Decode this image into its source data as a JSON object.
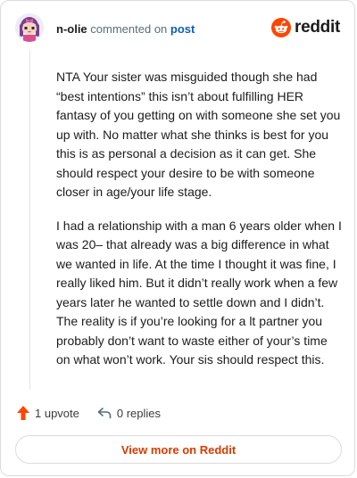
{
  "header": {
    "username": "n-olie",
    "verb": "commented on",
    "post_link": "post",
    "brand": "reddit"
  },
  "comment": {
    "paragraphs": [
      "NTA Your sister was misguided though she had “best intentions” this isn’t about fulfilling HER fantasy of you getting on with someone she set you up with. No matter what she thinks is best for you this is as personal a decision as it can get. She should respect your desire to be with someone closer in age/your life stage.",
      "I had a relationship with a man 6 years older when I was 20– that already was a big difference in what we wanted in life. At the time I thought it was fine, I really liked him. But it didn’t really work when a few years later he wanted to settle down and I didn’t. The reality is if you’re looking for a lt partner you probably don’t want to waste either of your’s time on what won’t work. Your sis should respect this."
    ]
  },
  "actions": {
    "upvotes": "1 upvote",
    "replies": "0 replies"
  },
  "footer": {
    "view_more": "View more on Reddit"
  },
  "colors": {
    "brand_orange": "#ff4500",
    "link_blue": "#0a5fb4",
    "view_more_text": "#d93a00",
    "upvote_arrow": "#ff4500"
  },
  "icons": {
    "avatar": "avatar-image",
    "logo": "reddit-snoo-icon",
    "upvote": "upvote-arrow-icon",
    "reply": "reply-arrow-icon"
  }
}
